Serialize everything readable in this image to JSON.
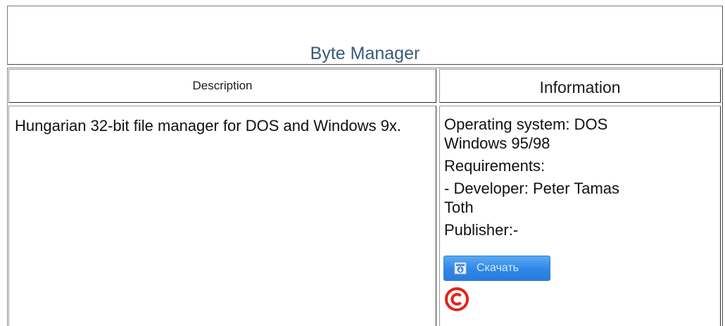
{
  "title": "Byte Manager",
  "table": {
    "headers": {
      "description": "Description",
      "information": "Information"
    },
    "description_text": "Hungarian 32-bit file manager for DOS and Windows 9x.",
    "info": {
      "os_line1": "Operating system: DOS",
      "os_line2": "Windows 95/98",
      "requirements": "Requirements:",
      "developer_line1": "- Developer: Peter Tamas",
      "developer_line2": "Toth",
      "publisher": "Publisher:-"
    },
    "download_button": {
      "label": "Скачать",
      "icon": "download-icon"
    },
    "copyright_icon": "copyright-icon"
  },
  "colors": {
    "title": "#3b5b78",
    "button": "#2f86e6",
    "copyright": "#e2231a"
  }
}
